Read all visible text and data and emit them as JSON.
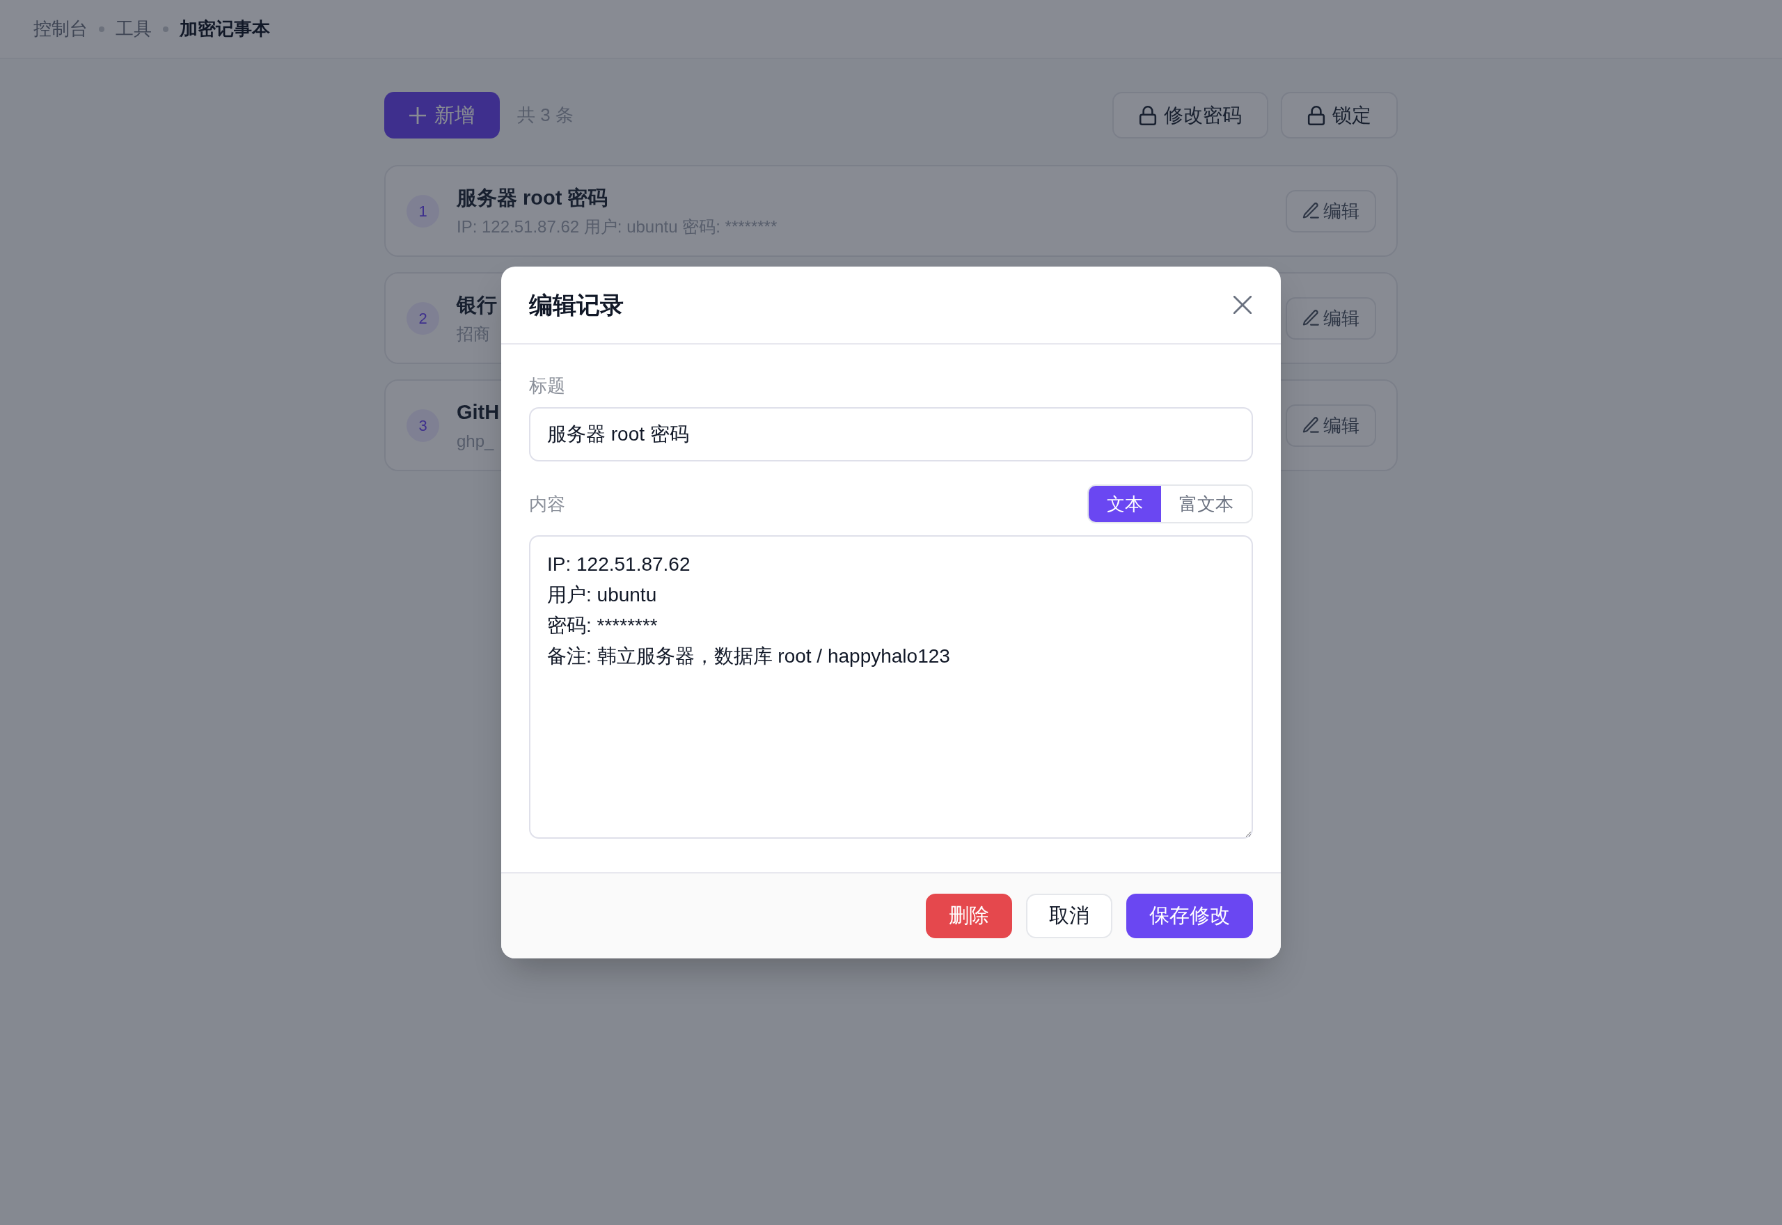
{
  "breadcrumb": [
    {
      "label": "控制台",
      "current": false
    },
    {
      "label": "工具",
      "current": false
    },
    {
      "label": "加密记事本",
      "current": true
    }
  ],
  "toolbar": {
    "add_button": "新增",
    "count": "共 3 条",
    "actions": [
      {
        "label": "修改密码"
      },
      {
        "label": "锁定"
      }
    ]
  },
  "records": [
    {
      "number": "1",
      "title": "服务器 root 密码",
      "preview": "IP: 122.51.87.62 用户: ubuntu 密码: ********",
      "edit_button": "编辑"
    },
    {
      "number": "2",
      "title": "银行",
      "preview": "招商",
      "edit_button": "编辑"
    },
    {
      "number": "3",
      "title": "GitH",
      "preview": "ghp_",
      "edit_button": "编辑"
    }
  ],
  "dialog": {
    "title": "编辑记录",
    "title_label": "标题",
    "title_value": "服务器 root 密码",
    "content_label": "内容",
    "content_modes": [
      {
        "label": "文本",
        "selected": true
      },
      {
        "label": "富文本",
        "selected": false
      }
    ],
    "content_value": "IP: 122.51.87.62\n用户: ubuntu\n密码: ********\n备注: 韩立服务器，数据库 root / happyhalo123",
    "buttons": [
      {
        "label": "删除",
        "kind": "danger"
      },
      {
        "label": "取消",
        "kind": "secondary"
      },
      {
        "label": "保存修改",
        "kind": "primary"
      }
    ]
  }
}
